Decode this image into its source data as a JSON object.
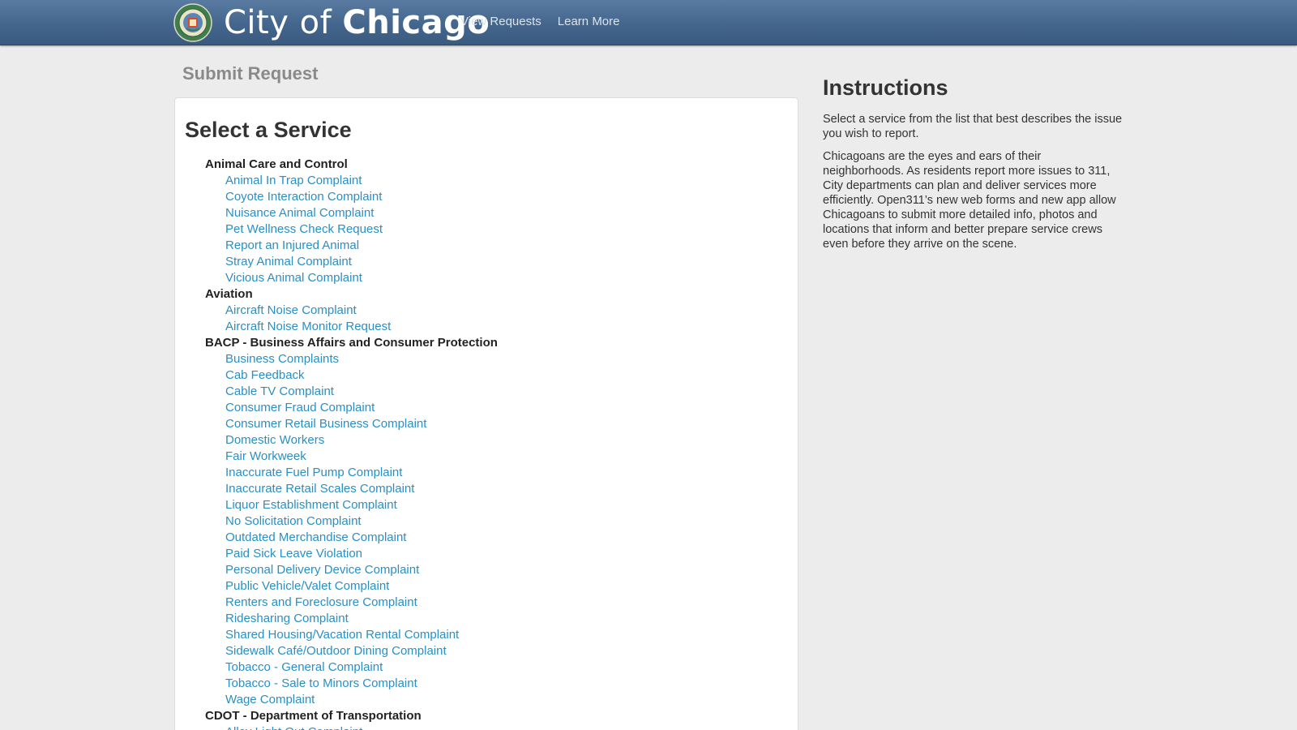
{
  "header": {
    "brand_light": "City of ",
    "brand_bold": "Chicago",
    "nav": [
      "View Requests",
      "Learn More"
    ]
  },
  "page": {
    "title": "Submit Request"
  },
  "panel": {
    "title": "Select a Service"
  },
  "departments": [
    {
      "name": "Animal Care and Control",
      "services": [
        "Animal In Trap Complaint",
        "Coyote Interaction Complaint",
        "Nuisance Animal Complaint",
        "Pet Wellness Check Request",
        "Report an Injured Animal",
        "Stray Animal Complaint",
        "Vicious Animal Complaint"
      ]
    },
    {
      "name": "Aviation",
      "services": [
        "Aircraft Noise Complaint",
        "Aircraft Noise Monitor Request"
      ]
    },
    {
      "name": "BACP - Business Affairs and Consumer Protection",
      "services": [
        "Business Complaints",
        "Cab Feedback",
        "Cable TV Complaint",
        "Consumer Fraud Complaint",
        "Consumer Retail Business Complaint",
        "Domestic Workers",
        "Fair Workweek",
        "Inaccurate Fuel Pump Complaint",
        "Inaccurate Retail Scales Complaint",
        "Liquor Establishment Complaint",
        "No Solicitation Complaint",
        "Outdated Merchandise Complaint",
        "Paid Sick Leave Violation",
        "Personal Delivery Device Complaint",
        "Public Vehicle/Valet Complaint",
        "Renters and Foreclosure Complaint",
        "Ridesharing Complaint",
        "Shared Housing/Vacation Rental Complaint",
        "Sidewalk Café/Outdoor Dining Complaint",
        "Tobacco - General Complaint",
        "Tobacco - Sale to Minors Complaint",
        "Wage Complaint"
      ]
    },
    {
      "name": "CDOT - Department of Transportation",
      "services": [
        "Alley Light Out Complaint"
      ]
    }
  ],
  "instructions": {
    "title": "Instructions",
    "paragraphs": [
      "Select a service from the list that best describes the issue you wish to report.",
      "Chicagoans are the eyes and ears of their neighborhoods. As residents report more issues to 311, City departments can plan and deliver services more efficiently. Open311’s new web forms and new app allow Chicagoans to submit more detailed info, photos and locations that inform and better prepare service crews even before they arrive on the scene."
    ]
  },
  "colors": {
    "header": "#45668c",
    "link": "#2a8fc4",
    "page_bg": "#ececec"
  }
}
